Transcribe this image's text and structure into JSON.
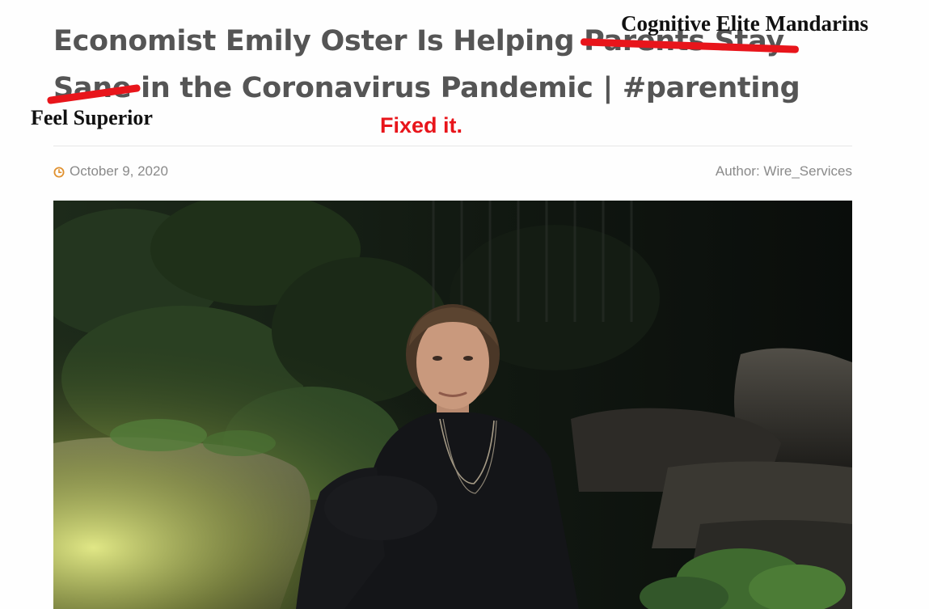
{
  "headline": {
    "part1": "Economist Emily Oster Is Helping ",
    "struck1": "Parents Stay",
    "struck2": "Sane",
    "part2": " in the Coronavirus Pandemic | #parenting"
  },
  "annotations": {
    "replacement_top": "Cognitive Elite Mandarins",
    "replacement_left": "Feel Superior",
    "fixed_note": "Fixed it."
  },
  "meta": {
    "date": "October 9, 2020",
    "author_label": "Author:",
    "author_name": "Wire_Services"
  },
  "icons": {
    "date_icon": "clock-icon"
  },
  "colors": {
    "headline_text": "#555555",
    "strike_red": "#e8151b",
    "meta_text": "#8a8a8a",
    "clock_orange": "#e0912f"
  }
}
